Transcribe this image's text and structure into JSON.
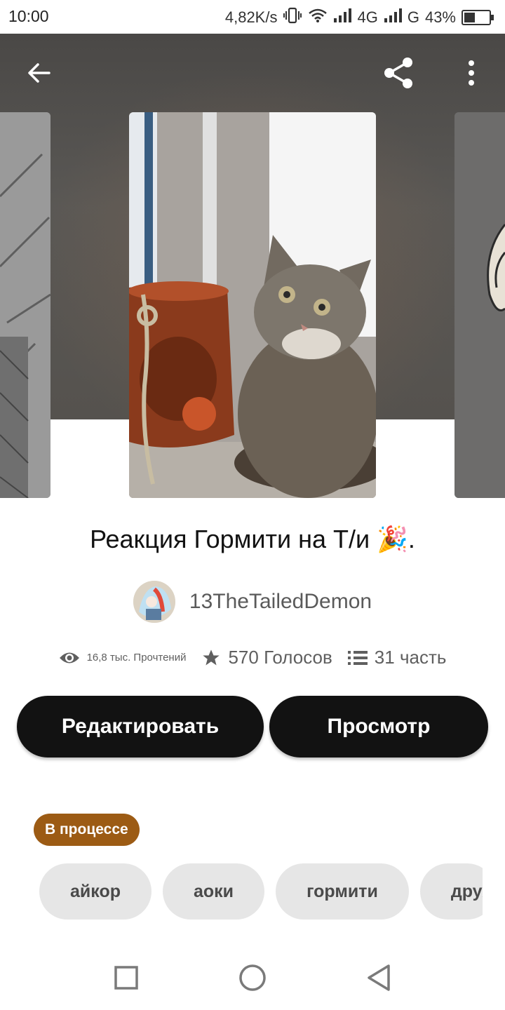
{
  "status_bar": {
    "time": "10:00",
    "speed": "4,82K/s",
    "network_1": "4G",
    "network_2": "G",
    "battery": "43%",
    "battery_level": 0.43
  },
  "top_bar": {
    "back_icon": "arrow-left-icon",
    "share_icon": "share-icon",
    "more_icon": "more-vertical-icon"
  },
  "story": {
    "title": "Реакция Гормити на Т/и 🎉.",
    "author": "13TheTailedDemon",
    "reads": "16,8 тыс. Прочтений",
    "votes": "570 Голосов",
    "parts": "31 часть",
    "status": "В процессе"
  },
  "actions": {
    "edit_label": "Редактировать",
    "view_label": "Просмотр"
  },
  "tags": [
    "айкор",
    "аоки",
    "гормити",
    "друж"
  ],
  "colors": {
    "button_bg": "#121212",
    "status_badge": "#9c5b14",
    "tag_bg": "#e6e6e6"
  }
}
